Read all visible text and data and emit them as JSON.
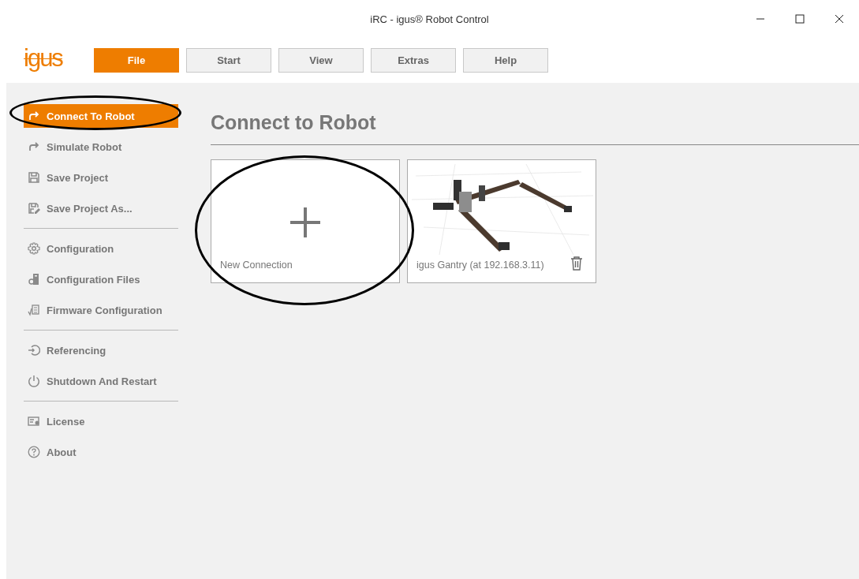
{
  "window": {
    "title": "iRC - igus® Robot Control"
  },
  "logo": "igus",
  "menu": [
    {
      "label": "File",
      "selected": true
    },
    {
      "label": "Start",
      "selected": false
    },
    {
      "label": "View",
      "selected": false
    },
    {
      "label": "Extras",
      "selected": false
    },
    {
      "label": "Help",
      "selected": false
    }
  ],
  "sidebar": {
    "groups": [
      {
        "items": [
          {
            "label": "Connect To Robot",
            "kind": "connect",
            "selected": true,
            "circled": true
          },
          {
            "label": "Simulate Robot",
            "kind": "connect",
            "selected": false,
            "circled": false
          },
          {
            "label": "Save Project",
            "kind": "save",
            "selected": false,
            "circled": false
          },
          {
            "label": "Save Project As...",
            "kind": "saveas",
            "selected": false,
            "circled": false
          }
        ]
      },
      {
        "items": [
          {
            "label": "Configuration",
            "kind": "gear",
            "selected": false,
            "circled": false
          },
          {
            "label": "Configuration Files",
            "kind": "files",
            "selected": false,
            "circled": false
          },
          {
            "label": "Firmware Configuration",
            "kind": "firmware",
            "selected": false,
            "circled": false
          }
        ]
      },
      {
        "items": [
          {
            "label": "Referencing",
            "kind": "reference",
            "selected": false,
            "circled": false
          },
          {
            "label": "Shutdown And Restart",
            "kind": "power",
            "selected": false,
            "circled": false
          }
        ]
      },
      {
        "items": [
          {
            "label": "License",
            "kind": "license",
            "selected": false,
            "circled": false
          },
          {
            "label": "About",
            "kind": "help",
            "selected": false,
            "circled": false
          }
        ]
      }
    ]
  },
  "main": {
    "heading": "Connect to Robot",
    "cards": [
      {
        "kind": "new",
        "label": "New Connection",
        "circled": true
      },
      {
        "kind": "robot",
        "label": "igus Gantry (at 192.168.3.11)",
        "circled": false
      }
    ]
  }
}
